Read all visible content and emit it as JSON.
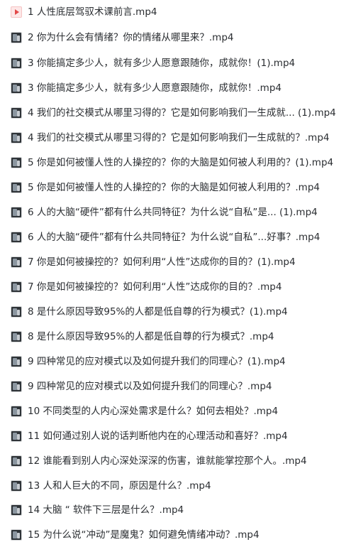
{
  "files": [
    {
      "name": "1 人性底层驾驭术课前言.mp4",
      "icon": "play-icon"
    },
    {
      "name": "2 你为什么会有情绪？你的情绪从哪里来？.mp4",
      "icon": "video-thumbnail-icon"
    },
    {
      "name": "3 你能搞定多少人，就有多少人愿意跟随你，成就你！(1).mp4",
      "icon": "video-thumbnail-icon"
    },
    {
      "name": "3 你能搞定多少人，就有多少人愿意跟随你，成就你！.mp4",
      "icon": "video-thumbnail-icon"
    },
    {
      "name": "4 我们的社交模式从哪里习得的？它是如何影响我们一生成就... (1).mp4",
      "icon": "video-thumbnail-icon"
    },
    {
      "name": "4 我们的社交模式从哪里习得的？它是如何影响我们一生成就的？.mp4",
      "icon": "video-thumbnail-icon"
    },
    {
      "name": "5 你是如何被懂人性的人操控的？你的大脑是如何被人利用的？(1).mp4",
      "icon": "video-thumbnail-icon"
    },
    {
      "name": "5 你是如何被懂人性的人操控的？你的大脑是如何被人利用的？.mp4",
      "icon": "video-thumbnail-icon"
    },
    {
      "name": "6 人的大脑“硬件”都有什么共同特征？为什么说“自私”是... (1).mp4",
      "icon": "video-thumbnail-icon"
    },
    {
      "name": "6 人的大脑“硬件”都有什么共同特征？为什么说“自私”...好事？.mp4",
      "icon": "video-thumbnail-icon"
    },
    {
      "name": "7 你是如何被操控的？如何利用“人性”达成你的目的？(1).mp4",
      "icon": "video-thumbnail-icon"
    },
    {
      "name": "7 你是如何被操控的？如何利用“人性”达成你的目的？.mp4",
      "icon": "video-thumbnail-icon"
    },
    {
      "name": "8 是什么原因导致95%的人都是低自尊的行为模式？(1).mp4",
      "icon": "video-thumbnail-icon"
    },
    {
      "name": "8 是什么原因导致95%的人都是低自尊的行为模式？.mp4",
      "icon": "video-thumbnail-icon"
    },
    {
      "name": "9 四种常见的应对模式以及如何提升我们的同理心？(1).mp4",
      "icon": "video-thumbnail-icon"
    },
    {
      "name": "9 四种常见的应对模式以及如何提升我们的同理心？.mp4",
      "icon": "video-thumbnail-icon"
    },
    {
      "name": "10 不同类型的人内心深处需求是什么？如何去相处？.mp4",
      "icon": "video-thumbnail-icon"
    },
    {
      "name": "11 如何通过别人说的话判断他内在的心理活动和喜好？.mp4",
      "icon": "video-thumbnail-icon"
    },
    {
      "name": "12 谁能看到别人内心深处深深的伤害，谁就能掌控那个人。.mp4",
      "icon": "video-thumbnail-icon"
    },
    {
      "name": "13 人和人巨大的不同，原因是什么？.mp4",
      "icon": "video-thumbnail-icon"
    },
    {
      "name": "14 大脑 “ 软件下三层是什么？.mp4",
      "icon": "video-thumbnail-icon"
    },
    {
      "name": "15 为什么说“冲动”是魔鬼？如何避免情绪冲动？.mp4",
      "icon": "video-thumbnail-icon"
    }
  ]
}
